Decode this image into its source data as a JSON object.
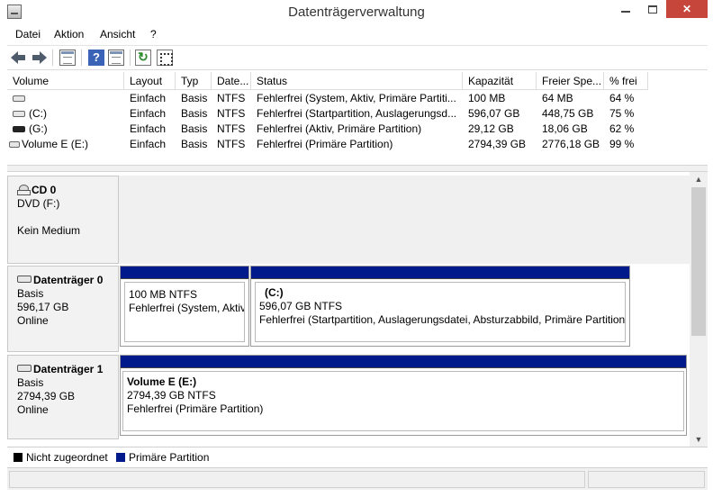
{
  "window": {
    "title": "Datenträgerverwaltung",
    "close_glyph": "✕"
  },
  "menu": {
    "items": [
      "Datei",
      "Aktion",
      "Ansicht",
      "?"
    ]
  },
  "toolbar": {
    "icons": [
      "back-arrow-icon",
      "forward-arrow-icon",
      "console-tree-icon",
      "help-icon",
      "help-panel-icon",
      "refresh-icon",
      "properties-icon"
    ]
  },
  "volume_table": {
    "headers": [
      "Volume",
      "Layout",
      "Typ",
      "Date...",
      "Status",
      "Kapazität",
      "Freier Spe...",
      "% frei"
    ],
    "rows": [
      {
        "volume": "",
        "layout": "Einfach",
        "typ": "Basis",
        "dateisystem": "NTFS",
        "status": "Fehlerfrei (System, Aktiv, Primäre Partiti...",
        "kapazitaet": "100 MB",
        "frei": "64 MB",
        "prozent": "64 %"
      },
      {
        "volume": "(C:)",
        "layout": "Einfach",
        "typ": "Basis",
        "dateisystem": "NTFS",
        "status": "Fehlerfrei (Startpartition, Auslagerungsd...",
        "kapazitaet": "596,07 GB",
        "frei": "448,75 GB",
        "prozent": "75 %"
      },
      {
        "volume": "(G:)",
        "layout": "Einfach",
        "typ": "Basis",
        "dateisystem": "NTFS",
        "status": "Fehlerfrei (Aktiv, Primäre Partition)",
        "kapazitaet": "29,12 GB",
        "frei": "18,06 GB",
        "prozent": "62 %"
      },
      {
        "volume": "Volume E (E:)",
        "layout": "Einfach",
        "typ": "Basis",
        "dateisystem": "NTFS",
        "status": "Fehlerfrei (Primäre Partition)",
        "kapazitaet": "2794,39 GB",
        "frei": "2776,18 GB",
        "prozent": "99 %"
      }
    ]
  },
  "disks": {
    "cd0": {
      "name": "CD 0",
      "drive": "DVD (F:)",
      "media": "Kein Medium"
    },
    "disk0": {
      "name": "Datenträger 0",
      "type": "Basis",
      "size": "596,17 GB",
      "state": "Online",
      "partitions": [
        {
          "title": "",
          "size": "100 MB NTFS",
          "status": "Fehlerfrei (System, Aktiv, Primäre Partition)"
        },
        {
          "title": "(C:)",
          "size": "596,07 GB NTFS",
          "status": "Fehlerfrei (Startpartition, Auslagerungsdatei, Absturzabbild, Primäre Partition)"
        }
      ]
    },
    "disk1": {
      "name": "Datenträger 1",
      "type": "Basis",
      "size": "2794,39 GB",
      "state": "Online",
      "partitions": [
        {
          "title": "Volume E  (E:)",
          "size": "2794,39 GB NTFS",
          "status": "Fehlerfrei (Primäre Partition)"
        }
      ]
    }
  },
  "legend": {
    "items": [
      {
        "label": "Nicht zugeordnet",
        "color": "#000000"
      },
      {
        "label": "Primäre Partition",
        "color": "#001a8c"
      }
    ]
  }
}
